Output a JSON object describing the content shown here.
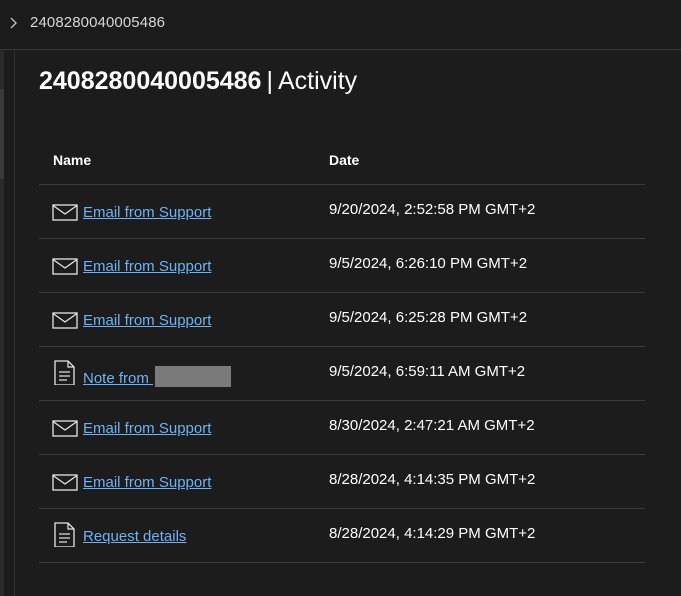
{
  "breadcrumb": {
    "current": "2408280040005486"
  },
  "page": {
    "id": "2408280040005486",
    "separator": "|",
    "section": "Activity"
  },
  "table": {
    "columns": {
      "name": "Name",
      "date": "Date"
    },
    "rows": [
      {
        "icon": "mail-icon",
        "label": "Email from Support",
        "date": "9/20/2024, 2:52:58 PM GMT+2"
      },
      {
        "icon": "mail-icon",
        "label": "Email from Support",
        "date": "9/5/2024, 6:26:10 PM GMT+2"
      },
      {
        "icon": "mail-icon",
        "label": "Email from Support",
        "date": "9/5/2024, 6:25:28 PM GMT+2"
      },
      {
        "icon": "document-icon",
        "label": "Note from",
        "redacted": true,
        "date": "9/5/2024, 6:59:11 AM GMT+2"
      },
      {
        "icon": "mail-icon",
        "label": "Email from Support",
        "date": "8/30/2024, 2:47:21 AM GMT+2"
      },
      {
        "icon": "mail-icon",
        "label": "Email from Support",
        "date": "8/28/2024, 4:14:35 PM GMT+2"
      },
      {
        "icon": "document-icon",
        "label": "Request details",
        "date": "8/28/2024, 4:14:29 PM GMT+2"
      }
    ]
  },
  "colors": {
    "link": "#6cb4f7",
    "background": "#1c1c1c",
    "divider": "#3b3b3b"
  }
}
